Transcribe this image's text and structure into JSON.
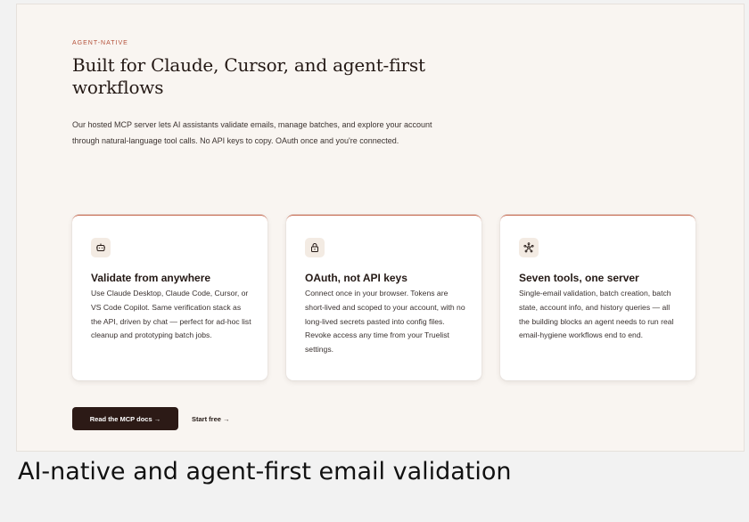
{
  "section": {
    "eyebrow": "AGENT-NATIVE",
    "headline": "Built for Claude, Cursor, and agent-first workflows",
    "intro": "Our hosted MCP server lets AI assistants validate emails, manage batches, and explore your account through natural-language tool calls. No API keys to copy. OAuth once and you're connected."
  },
  "cards": [
    {
      "icon": "robot-icon",
      "title": "Validate from anywhere",
      "body": "Use Claude Desktop, Claude Code, Cursor, or VS Code Copilot. Same verification stack as the API, driven by chat — perfect for ad-hoc list cleanup and prototyping batch jobs."
    },
    {
      "icon": "lock-icon",
      "title": "OAuth, not API keys",
      "body": "Connect once in your browser. Tokens are short-lived and scoped to your account, with no long-lived secrets pasted into config files. Revoke access any time from your Truelist settings."
    },
    {
      "icon": "network-icon",
      "title": "Seven tools, one server",
      "body": "Single-email validation, batch creation, batch state, account info, and history queries — all the building blocks an agent needs to run real email-hygiene workflows end to end."
    }
  ],
  "actions": {
    "primary_label": "Read the MCP docs →",
    "secondary_label": "Start free →"
  },
  "caption": "AI-native and agent-first email validation",
  "colors": {
    "accent": "#c05a3e",
    "eyebrow": "#b4513a",
    "primary_button": "#2c1a16",
    "section_background": "#f9f5f1",
    "icon_background": "#f3ebe3"
  }
}
